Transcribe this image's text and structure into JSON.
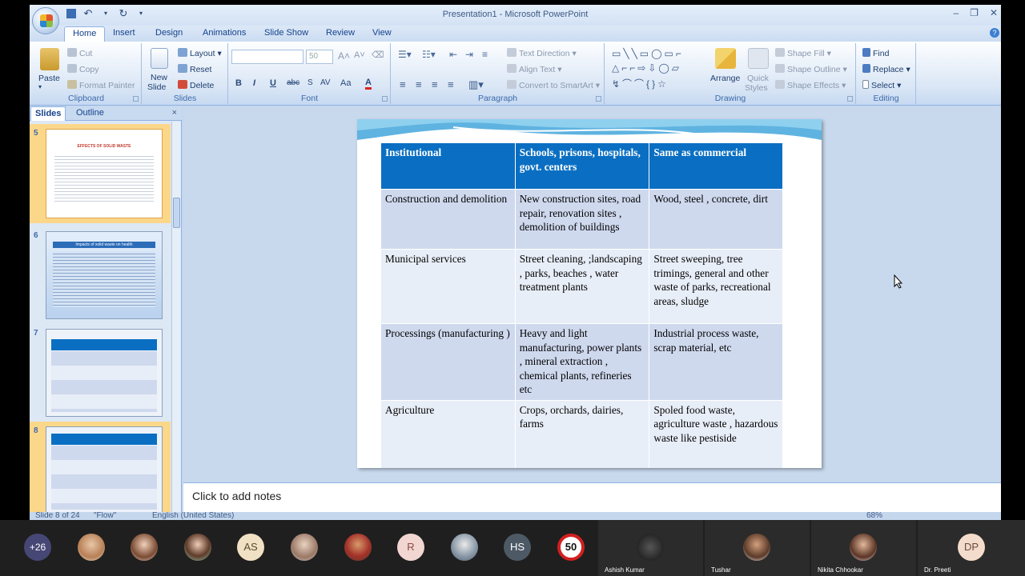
{
  "window": {
    "title": "Presentation1 - Microsoft PowerPoint"
  },
  "ribbon": {
    "tabs": [
      "Home",
      "Insert",
      "Design",
      "Animations",
      "Slide Show",
      "Review",
      "View"
    ],
    "clipboard": {
      "paste": "Paste",
      "cut": "Cut",
      "copy": "Copy",
      "format_painter": "Format Painter",
      "label": "Clipboard"
    },
    "slides": {
      "new_slide_1": "New",
      "new_slide_2": "Slide",
      "layout": "Layout",
      "reset": "Reset",
      "delete": "Delete",
      "label": "Slides"
    },
    "font": {
      "size": "50",
      "label": "Font"
    },
    "paragraph": {
      "text_direction": "Text Direction",
      "align_text": "Align Text",
      "convert_smartart": "Convert to SmartArt",
      "label": "Paragraph"
    },
    "drawing": {
      "arrange": "Arrange",
      "quick_styles_1": "Quick",
      "quick_styles_2": "Styles",
      "shape_fill": "Shape Fill",
      "shape_outline": "Shape Outline",
      "shape_effects": "Shape Effects",
      "label": "Drawing"
    },
    "editing": {
      "find": "Find",
      "replace": "Replace",
      "select": "Select",
      "label": "Editing"
    }
  },
  "pane": {
    "tab_slides": "Slides",
    "tab_outline": "Outline",
    "thumb_numbers": [
      "5",
      "6",
      "7",
      "8"
    ],
    "thumb5_title": "EFFECTS OF SOLID WASTE",
    "thumb6_title": "Impacts of solid waste on health"
  },
  "slide_table": {
    "header": [
      "Institutional",
      "Schools, prisons, hospitals, govt. centers",
      "Same as commercial"
    ],
    "rows": [
      [
        "Construction and demolition",
        "New construction sites, road repair, renovation sites , demolition of buildings",
        "Wood, steel , concrete, dirt"
      ],
      [
        "Municipal services",
        "Street cleaning, ;landscaping ,  parks, beaches , water treatment plants",
        "Street sweeping, tree trimings, general and other waste of parks, recreational areas, sludge"
      ],
      [
        "Processings (manufacturing )",
        "Heavy and light manufacturing, power plants , mineral extraction , chemical plants, refineries etc",
        "Industrial process waste, scrap material, etc"
      ],
      [
        "Agriculture",
        "Crops, orchards, dairies, farms",
        "Spoled food waste, agriculture waste , hazardous waste like pestiside"
      ]
    ]
  },
  "notes": {
    "placeholder": "Click to add notes"
  },
  "status": {
    "slide": "Slide 8 of 24",
    "theme": "\"Flow\"",
    "language": "English (United States)",
    "zoom": "68%"
  },
  "meeting": {
    "participants_more": "+26",
    "initials": [
      "AS",
      "R",
      "HS",
      "50"
    ],
    "tiles": [
      "Ashish Kumar",
      "Tushar",
      "Nikita Chhookar",
      "Dr. Preeti"
    ],
    "dp": "DP"
  }
}
